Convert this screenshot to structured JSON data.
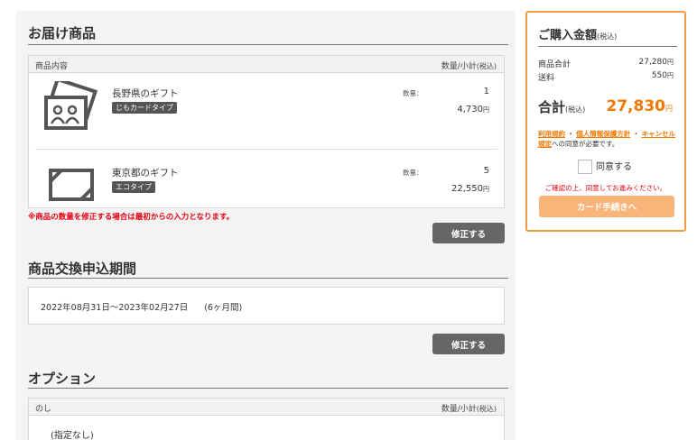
{
  "delivery": {
    "title": "お届け商品",
    "col_left": "商品内容",
    "col_right_main": "数量/小計",
    "col_right_tax": "(税込)",
    "items": [
      {
        "name": "長野県のギフト",
        "tag": "じもカードタイプ",
        "qty_label": "数量：",
        "qty": "1",
        "price": "4,730",
        "yen": "円",
        "icon": "photo-card-icon"
      },
      {
        "name": "東京都のギフト",
        "tag": "エコタイプ",
        "qty_label": "数量：",
        "qty": "5",
        "price": "22,550",
        "yen": "円",
        "icon": "eco-card-icon"
      }
    ],
    "warning": "※商品の数量を修正する場合は最初からの入力となります。",
    "edit_label": "修正する"
  },
  "exchange": {
    "title": "商品交換申込期間",
    "period": "2022年08月31日～2023年02月27日",
    "duration": "(6ヶ月間)",
    "edit_label": "修正する"
  },
  "option": {
    "title": "オプション",
    "col_left": "のし",
    "col_right_main": "数量/小計",
    "col_right_tax": "(税込)",
    "value": "(指定なし)"
  },
  "summary": {
    "title": "ご購入金額",
    "title_tax": "(税込)",
    "subtotal_label": "商品合計",
    "subtotal_value": "27,280",
    "shipping_label": "送料",
    "shipping_value": "550",
    "yen": "円",
    "total_label": "合計",
    "total_tax": "(税込)",
    "total_value": "27,830",
    "terms_link": "利用規約",
    "privacy_link": "個人情報保護方針",
    "cancel_link": "キャンセル規定",
    "terms_sep": "・",
    "terms_suffix": "への同意が必要です。",
    "agree_label": "同意する",
    "agree_warning": "ご確認の上、同意してお進みください。",
    "proceed_label": "カード手続きへ"
  },
  "colors": {
    "accent": "#f07800",
    "border_accent": "#f39a42",
    "warning": "#e60012",
    "button_dark": "#666666"
  }
}
